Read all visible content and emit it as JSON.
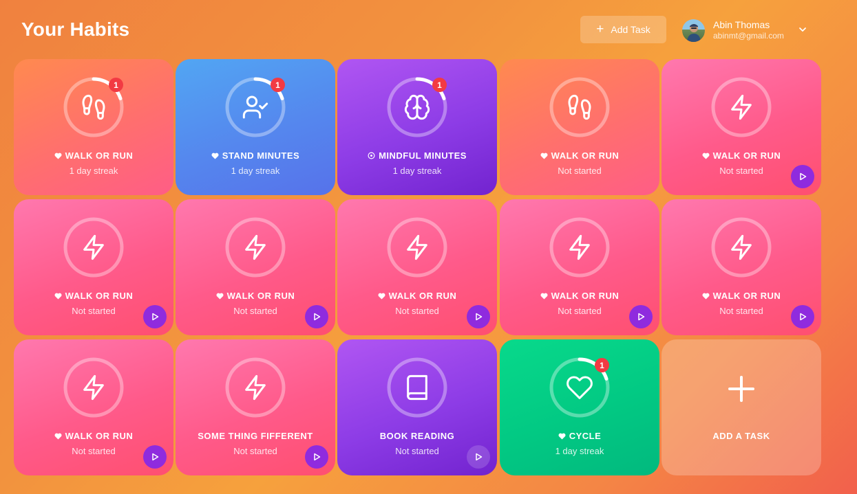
{
  "header": {
    "title": "Your Habits",
    "add_task_label": "Add Task",
    "add_task_icon": "plus-icon"
  },
  "user": {
    "name": "Abin Thomas",
    "email": "abinmt@gmail.com",
    "menu_icon": "chevron-down-icon"
  },
  "colors": {
    "pink": "#ff5a8a",
    "orange": "#ff7466",
    "blue": "#5587ee",
    "purple": "#8d3ce6",
    "green": "#02c983",
    "badge": "#f23a43",
    "play_button": "#8f2bde"
  },
  "cards": [
    {
      "label": "WALK OR RUN",
      "status": "1 day streak",
      "icon": "footsteps-icon",
      "badge": "1",
      "progress": 0.2
    },
    {
      "label": "STAND MINUTES",
      "status": "1 day streak",
      "icon": "user-check-icon",
      "badge": "1",
      "progress": 0.2
    },
    {
      "label": "MINDFUL MINUTES",
      "status": "1 day streak",
      "icon": "brain-icon",
      "badge": "1",
      "progress": 0.2
    },
    {
      "label": "WALK OR RUN",
      "status": "Not started",
      "icon": "footsteps-icon"
    },
    {
      "label": "WALK OR RUN",
      "status": "Not started",
      "icon": "lightning-icon"
    },
    {
      "label": "WALK OR RUN",
      "status": "Not started",
      "icon": "lightning-icon"
    },
    {
      "label": "WALK OR RUN",
      "status": "Not started",
      "icon": "lightning-icon"
    },
    {
      "label": "WALK OR RUN",
      "status": "Not started",
      "icon": "lightning-icon"
    },
    {
      "label": "WALK OR RUN",
      "status": "Not started",
      "icon": "lightning-icon"
    },
    {
      "label": "WALK OR RUN",
      "status": "Not started",
      "icon": "lightning-icon"
    },
    {
      "label": "WALK OR RUN",
      "status": "Not started",
      "icon": "lightning-icon"
    },
    {
      "label": "SOME THING FIFFERENT",
      "status": "Not started",
      "icon": "lightning-icon"
    },
    {
      "label": "BOOK READING",
      "status": "Not started",
      "icon": "book-icon"
    },
    {
      "label": "CYCLE",
      "status": "1 day streak",
      "icon": "heart-icon",
      "badge": "1",
      "progress": 0.2
    }
  ],
  "add_card": {
    "label": "ADD A TASK",
    "icon": "plus-icon"
  }
}
